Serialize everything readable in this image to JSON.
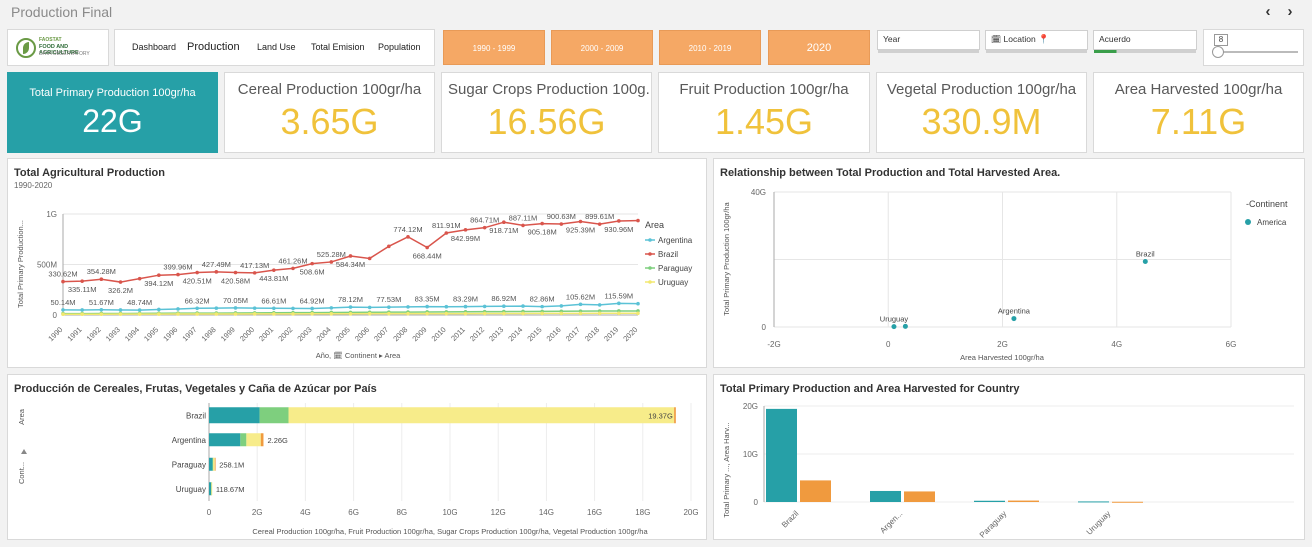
{
  "app": {
    "title": "Production Final"
  },
  "logo": {
    "line1": "FAOSTAT",
    "line2": "FOOD AND AGRICULTURE",
    "line3": "DATA OBSERVATORY"
  },
  "nav": {
    "prev": "‹",
    "next": "›",
    "links": [
      "Dashboard",
      "Production",
      "Land Use",
      "Total Emision",
      "Population"
    ],
    "active": "Production"
  },
  "periods": [
    "1990 - 1999",
    "2000 - 2009",
    "2010 - 2019",
    "2020"
  ],
  "filters": {
    "year": "Year",
    "location": "Location",
    "acuerdo": "Acuerdo",
    "slider_value": "8"
  },
  "kpis": [
    {
      "label": "Total Primary Production 100gr/ha",
      "value": "22G"
    },
    {
      "label": "Cereal Production 100gr/ha",
      "value": "3.65G"
    },
    {
      "label": "Sugar Crops Production 100g...",
      "value": "16.56G"
    },
    {
      "label": "Fruit Production 100gr/ha",
      "value": "1.45G"
    },
    {
      "label": "Vegetal Production 100gr/ha",
      "value": "330.9M"
    },
    {
      "label": "Area Harvested 100gr/ha",
      "value": "7.11G"
    }
  ],
  "colors": {
    "teal": "#26a0a7",
    "orange": "#f09a3e",
    "argentina": "#5bc2d6",
    "brazil": "#d9554c",
    "paraguay": "#7ecf7e",
    "uruguay": "#f2e870",
    "kpi_value": "#f0c23b",
    "period": "#f5a865"
  },
  "panels": {
    "line": {
      "title": "Total Agricultural Production",
      "subtitle": "1990-2020"
    },
    "scatter": {
      "title": "Relationship between Total Production and Total Harvested Area."
    },
    "hbar": {
      "title": "Producción de Cereales, Frutas, Vegetales y Caña de Azúcar por País"
    },
    "vbar": {
      "title": "Total Primary Production and Area Harvested for Country"
    }
  },
  "chart_data": [
    {
      "type": "line",
      "title": "Total Agricultural Production",
      "subtitle": "1990-2020",
      "ylabel": "Total Primary Production...",
      "xlabel": "Año, 🗓 Continent ▸ Area",
      "legend_title": "Area",
      "legend_position": "right",
      "y_ticks": [
        "0",
        "500M",
        "1G"
      ],
      "ylim": [
        0,
        1000000000
      ],
      "x": [
        "1990",
        "1991",
        "1992",
        "1993",
        "1994",
        "1995",
        "1996",
        "1997",
        "1998",
        "1999",
        "2000",
        "2001",
        "2002",
        "2003",
        "2004",
        "2005",
        "2006",
        "2007",
        "2008",
        "2009",
        "2010",
        "2011",
        "2012",
        "2013",
        "2014",
        "2015",
        "2016",
        "2017",
        "2018",
        "2019",
        "2020"
      ],
      "series": [
        {
          "name": "Argentina",
          "values": [
            50140000.0,
            50000000.0,
            51670000.0,
            50000000.0,
            48740000.0,
            55000000.0,
            60000000.0,
            66320000.0,
            68000000.0,
            70050000.0,
            68000000.0,
            66610000.0,
            65000000.0,
            64920000.0,
            70000000.0,
            78120000.0,
            75000000.0,
            77530000.0,
            80000000.0,
            83350000.0,
            82000000.0,
            83290000.0,
            85000000.0,
            86920000.0,
            88000000.0,
            82860000.0,
            90000000.0,
            105620000.0,
            100000000.0,
            115590000.0,
            112000000.0
          ]
        },
        {
          "name": "Brazil",
          "values": [
            330620000.0,
            335110000.0,
            354280000.0,
            326200000.0,
            360000000.0,
            394120000.0,
            399960000.0,
            420510000.0,
            427490000.0,
            420580000.0,
            417130000.0,
            443810000.0,
            461260000.0,
            508600000.0,
            525280000.0,
            584340000.0,
            560000000.0,
            680000000.0,
            774120000.0,
            668440000.0,
            811910000.0,
            842990000.0,
            864710000.0,
            918710000.0,
            887110000.0,
            905180000.0,
            900630000.0,
            925390000.0,
            899610000.0,
            930960000.0,
            935000000.0
          ]
        },
        {
          "name": "Paraguay",
          "values": [
            14000000.0,
            14000000.0,
            15000000.0,
            15000000.0,
            16000000.0,
            17000000.0,
            18000000.0,
            19000000.0,
            19000000.0,
            20000000.0,
            21000000.0,
            22000000.0,
            23000000.0,
            24000000.0,
            25000000.0,
            26000000.0,
            27000000.0,
            28000000.0,
            29000000.0,
            30000000.0,
            31000000.0,
            32000000.0,
            33000000.0,
            34000000.0,
            35000000.0,
            36000000.0,
            37000000.0,
            38000000.0,
            39000000.0,
            40000000.0,
            40000000.0
          ]
        },
        {
          "name": "Uruguay",
          "values": [
            8000000.0,
            8000000.0,
            8000000.0,
            9000000.0,
            9000000.0,
            9000000.0,
            10000000.0,
            10000000.0,
            10000000.0,
            10000000.0,
            11000000.0,
            11000000.0,
            11000000.0,
            12000000.0,
            12000000.0,
            12000000.0,
            13000000.0,
            13000000.0,
            13000000.0,
            14000000.0,
            14000000.0,
            14000000.0,
            15000000.0,
            15000000.0,
            15000000.0,
            16000000.0,
            16000000.0,
            16000000.0,
            17000000.0,
            17000000.0,
            17000000.0
          ]
        }
      ],
      "data_labels": [
        {
          "series": "Brazil",
          "index": 0,
          "text": "330.62M"
        },
        {
          "series": "Brazil",
          "index": 1,
          "text": "335.11M"
        },
        {
          "series": "Brazil",
          "index": 2,
          "text": "354.28M"
        },
        {
          "series": "Brazil",
          "index": 3,
          "text": "326.2M"
        },
        {
          "series": "Brazil",
          "index": 5,
          "text": "394.12M"
        },
        {
          "series": "Brazil",
          "index": 6,
          "text": "399.96M"
        },
        {
          "series": "Brazil",
          "index": 7,
          "text": "420.51M"
        },
        {
          "series": "Brazil",
          "index": 8,
          "text": "427.49M"
        },
        {
          "series": "Brazil",
          "index": 9,
          "text": "420.58M"
        },
        {
          "series": "Brazil",
          "index": 10,
          "text": "417.13M"
        },
        {
          "series": "Brazil",
          "index": 11,
          "text": "443.81M"
        },
        {
          "series": "Brazil",
          "index": 12,
          "text": "461.26M"
        },
        {
          "series": "Brazil",
          "index": 13,
          "text": "508.6M"
        },
        {
          "series": "Brazil",
          "index": 14,
          "text": "525.28M"
        },
        {
          "series": "Brazil",
          "index": 15,
          "text": "584.34M"
        },
        {
          "series": "Brazil",
          "index": 18,
          "text": "774.12M"
        },
        {
          "series": "Brazil",
          "index": 19,
          "text": "668.44M"
        },
        {
          "series": "Brazil",
          "index": 20,
          "text": "811.91M"
        },
        {
          "series": "Brazil",
          "index": 21,
          "text": "842.99M"
        },
        {
          "series": "Brazil",
          "index": 22,
          "text": "864.71M"
        },
        {
          "series": "Brazil",
          "index": 23,
          "text": "918.71M"
        },
        {
          "series": "Brazil",
          "index": 24,
          "text": "887.11M"
        },
        {
          "series": "Brazil",
          "index": 25,
          "text": "905.18M"
        },
        {
          "series": "Brazil",
          "index": 26,
          "text": "900.63M"
        },
        {
          "series": "Brazil",
          "index": 27,
          "text": "925.39M"
        },
        {
          "series": "Brazil",
          "index": 28,
          "text": "899.61M"
        },
        {
          "series": "Brazil",
          "index": 29,
          "text": "930.96M"
        },
        {
          "series": "Argentina",
          "index": 0,
          "text": "50.14M"
        },
        {
          "series": "Argentina",
          "index": 2,
          "text": "51.67M"
        },
        {
          "series": "Argentina",
          "index": 4,
          "text": "48.74M"
        },
        {
          "series": "Argentina",
          "index": 7,
          "text": "66.32M"
        },
        {
          "series": "Argentina",
          "index": 9,
          "text": "70.05M"
        },
        {
          "series": "Argentina",
          "index": 11,
          "text": "66.61M"
        },
        {
          "series": "Argentina",
          "index": 13,
          "text": "64.92M"
        },
        {
          "series": "Argentina",
          "index": 15,
          "text": "78.12M"
        },
        {
          "series": "Argentina",
          "index": 17,
          "text": "77.53M"
        },
        {
          "series": "Argentina",
          "index": 19,
          "text": "83.35M"
        },
        {
          "series": "Argentina",
          "index": 21,
          "text": "83.29M"
        },
        {
          "series": "Argentina",
          "index": 23,
          "text": "86.92M"
        },
        {
          "series": "Argentina",
          "index": 25,
          "text": "82.86M"
        },
        {
          "series": "Argentina",
          "index": 27,
          "text": "105.62M"
        },
        {
          "series": "Argentina",
          "index": 29,
          "text": "115.59M"
        }
      ]
    },
    {
      "type": "scatter",
      "title": "Relationship between Total Production and Total Harvested Area.",
      "xlabel": "Area Harvested 100gr/ha",
      "ylabel": "Total Primary Production 100gr/ha",
      "x_ticks": [
        "-2G",
        "0",
        "2G",
        "4G",
        "6G"
      ],
      "y_ticks": [
        "0",
        "40G"
      ],
      "xlim": [
        -2,
        6
      ],
      "ylim": [
        0,
        40
      ],
      "legend_title": "Continent",
      "legend_position": "right",
      "series": [
        {
          "name": "America",
          "points": [
            {
              "label": "Uruguay",
              "x": 0.1,
              "y": 0.1
            },
            {
              "label": "",
              "x": 0.3,
              "y": 0.2
            },
            {
              "label": "Argentina",
              "x": 2.2,
              "y": 2.5
            },
            {
              "label": "Brazil",
              "x": 4.5,
              "y": 19.4
            }
          ]
        }
      ]
    },
    {
      "type": "bar",
      "orientation": "horizontal",
      "stacked": true,
      "title": "Producción de Cereales, Frutas, Vegetales y Caña de Azúcar por País",
      "xlabel": "Cereal Production 100gr/ha, Fruit Production 100gr/ha, Sugar Crops Production 100gr/ha, Vegetal Production 100gr/ha",
      "ylabel": "Area",
      "y_axis_label_2": "Cont...",
      "x_ticks": [
        "0",
        "2G",
        "4G",
        "6G",
        "8G",
        "10G",
        "12G",
        "14G",
        "16G",
        "18G",
        "20G"
      ],
      "xlim": [
        0,
        20
      ],
      "categories": [
        "Brazil",
        "Argentina",
        "Paraguay",
        "Uruguay"
      ],
      "series": [
        {
          "color": "#26a0a7",
          "values": [
            2.1,
            1.3,
            0.15,
            0.09
          ]
        },
        {
          "color": "#7ecf7e",
          "values": [
            1.2,
            0.25,
            0.02,
            0.01
          ]
        },
        {
          "color": "#f7ec8a",
          "values": [
            16.0,
            0.6,
            0.07,
            0.02
          ]
        },
        {
          "color": "#f09a3e",
          "values": [
            0.07,
            0.11,
            0.018,
            0.0
          ]
        }
      ],
      "totals": [
        "19.37G",
        "2.26G",
        "258.1M",
        "118.67M"
      ]
    },
    {
      "type": "bar",
      "orientation": "vertical",
      "title": "Total Primary Production and Area Harvested for Country",
      "ylabel": "Total Primary ..., Area Harv...",
      "y_ticks": [
        "0",
        "10G",
        "20G"
      ],
      "ylim": [
        0,
        20
      ],
      "categories": [
        "Brazil",
        "Argen...",
        "Paraguay",
        "Uruguay"
      ],
      "series": [
        {
          "color": "#26a0a7",
          "values": [
            19.4,
            2.3,
            0.26,
            0.12
          ]
        },
        {
          "color": "#f09a3e",
          "values": [
            4.5,
            2.2,
            0.3,
            0.05
          ]
        }
      ]
    }
  ]
}
